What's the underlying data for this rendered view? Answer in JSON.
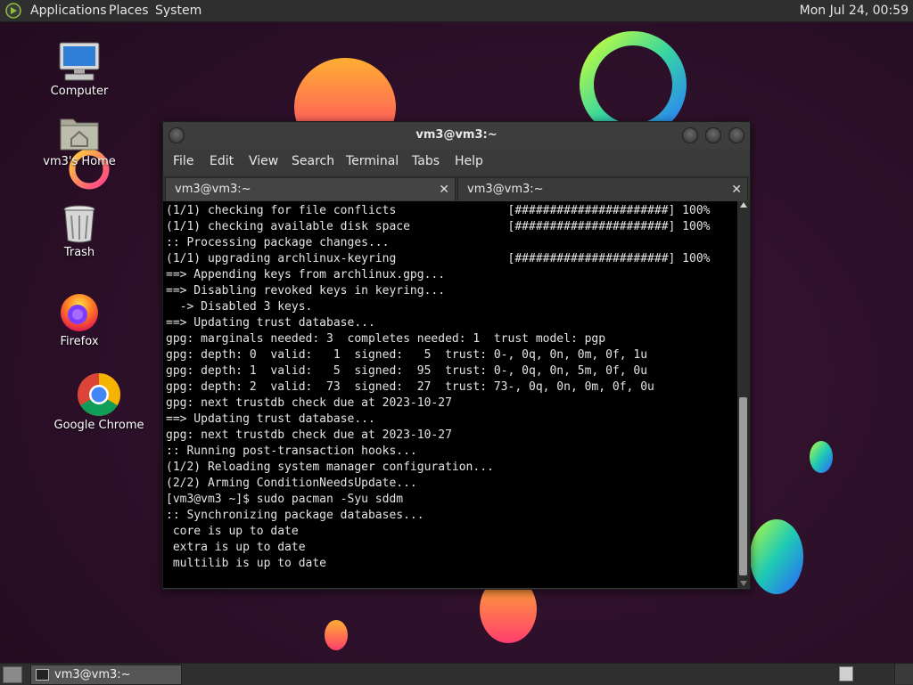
{
  "top_panel": {
    "menus": [
      "Applications",
      "Places",
      "System"
    ],
    "clock": "Mon Jul 24, 00:59"
  },
  "desktop": {
    "icons": [
      {
        "label": "Computer",
        "icon": "computer-icon"
      },
      {
        "label": "vm3's Home",
        "icon": "home-folder-icon"
      },
      {
        "label": "Trash",
        "icon": "trash-icon"
      },
      {
        "label": "Firefox",
        "icon": "firefox-icon"
      },
      {
        "label": "Google Chrome",
        "icon": "chrome-icon"
      }
    ]
  },
  "terminal": {
    "title": "vm3@vm3:~",
    "menu": [
      "File",
      "Edit",
      "View",
      "Search",
      "Terminal",
      "Tabs",
      "Help"
    ],
    "tabs": [
      {
        "label": "vm3@vm3:~",
        "close": "✕"
      },
      {
        "label": "vm3@vm3:~",
        "close": "✕"
      }
    ],
    "output": "(1/1) checking for file conflicts                [######################] 100%\n(1/1) checking available disk space              [######################] 100%\n:: Processing package changes...\n(1/1) upgrading archlinux-keyring                [######################] 100%\n==> Appending keys from archlinux.gpg...\n==> Disabling revoked keys in keyring...\n  -> Disabled 3 keys.\n==> Updating trust database...\ngpg: marginals needed: 3  completes needed: 1  trust model: pgp\ngpg: depth: 0  valid:   1  signed:   5  trust: 0-, 0q, 0n, 0m, 0f, 1u\ngpg: depth: 1  valid:   5  signed:  95  trust: 0-, 0q, 0n, 5m, 0f, 0u\ngpg: depth: 2  valid:  73  signed:  27  trust: 73-, 0q, 0n, 0m, 0f, 0u\ngpg: next trustdb check due at 2023-10-27\n==> Updating trust database...\ngpg: next trustdb check due at 2023-10-27\n:: Running post-transaction hooks...\n(1/2) Reloading system manager configuration...\n(2/2) Arming ConditionNeedsUpdate...\n[vm3@vm3 ~]$ sudo pacman -Syu sddm\n:: Synchronizing package databases...\n core is up to date\n extra is up to date\n multilib is up to date"
  },
  "bottom_panel": {
    "task_label": "vm3@vm3:~"
  },
  "colors": {
    "panel": "#2f2f2f",
    "terminal_bg": "#000000",
    "terminal_fg": "#e4e4e4",
    "wallpaper": "#2b1027"
  }
}
